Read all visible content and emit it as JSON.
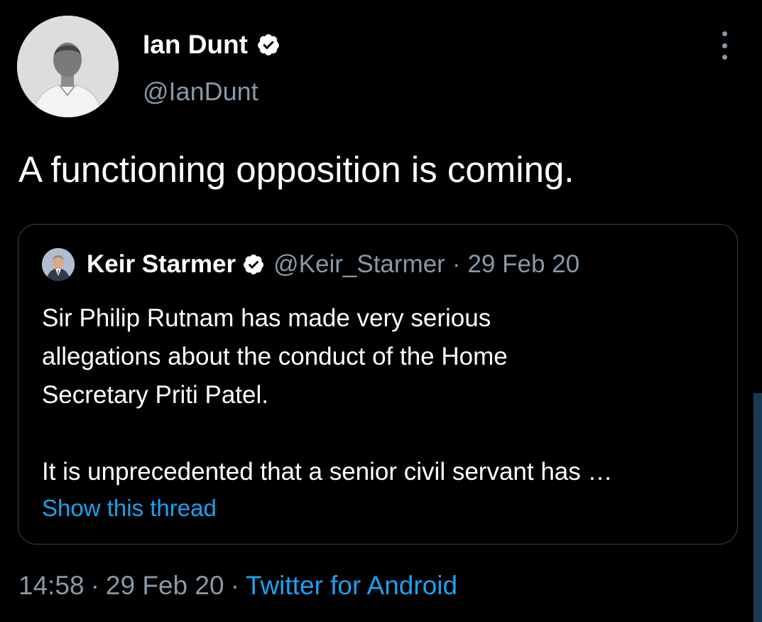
{
  "tweet": {
    "author": {
      "name": "Ian Dunt",
      "handle": "@IanDunt",
      "verified": true,
      "avatar_icon": "profile-photo"
    },
    "text": "A functioning opposition is coming.",
    "more_icon": "more-vertical-icon",
    "quoted": {
      "author_name": "Keir Starmer",
      "handle": "@Keir_Starmer",
      "separator": "·",
      "date": "29 Feb 20",
      "verified": true,
      "body_lines_p1": [
        "Sir Philip Rutnam has made very serious",
        "allegations about the conduct of the Home",
        "Secretary Priti Patel."
      ],
      "body_lines_p2": [
        "It is unprecedented that a senior civil servant has …"
      ],
      "show_thread": "Show this thread"
    },
    "meta": {
      "time": "14:58",
      "separator": "·",
      "date": "29 Feb 20",
      "source": "Twitter for Android"
    }
  },
  "colors": {
    "background": "#000000",
    "text": "#ffffff",
    "secondary": "#8899a6",
    "link": "#1da1f2",
    "border": "#38444d"
  }
}
